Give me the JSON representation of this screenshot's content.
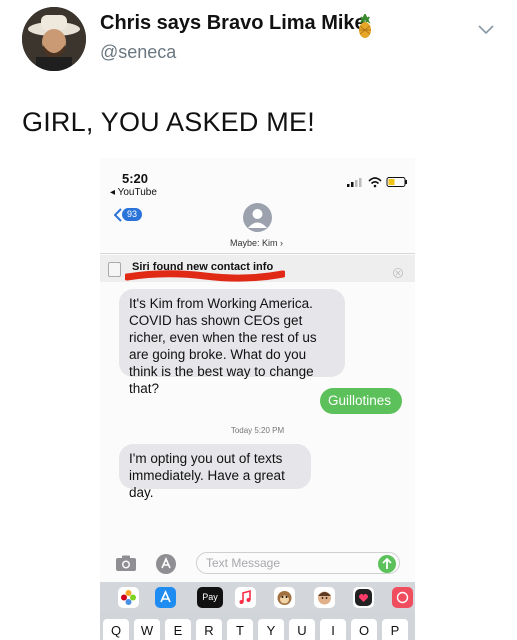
{
  "tweet": {
    "author_name": "Chris says Bravo Lima Mike",
    "author_handle": "@seneca",
    "text": "GIRL, YOU ASKED ME!"
  },
  "phone": {
    "status_time": "5:20",
    "status_back_label": "◂ YouTube",
    "unread_badge": "93",
    "contact_name": "Maybe: Kim ›",
    "siri_suggestion": "Siri found new contact info",
    "messages": [
      {
        "direction": "incoming",
        "text": "It's Kim from Working America. COVID has shown CEOs get richer, even when the rest of us are going broke. What do you think is the best way to change that?"
      },
      {
        "direction": "outgoing",
        "text": "Guillotines"
      },
      {
        "direction": "incoming",
        "text": "I'm opting you out of texts immediately. Have a great day."
      }
    ],
    "timestamp": "Today 5:20 PM",
    "input_placeholder": "Text Message",
    "app_strip_label_pay": "Pay",
    "keyboard_keys": [
      "Q",
      "W",
      "E",
      "R",
      "T",
      "Y",
      "U",
      "I",
      "O",
      "P"
    ],
    "colors": {
      "incoming_bubble": "#e6e6ea",
      "outgoing_bubble": "#5cc15a",
      "badge": "#2a73d9"
    }
  }
}
